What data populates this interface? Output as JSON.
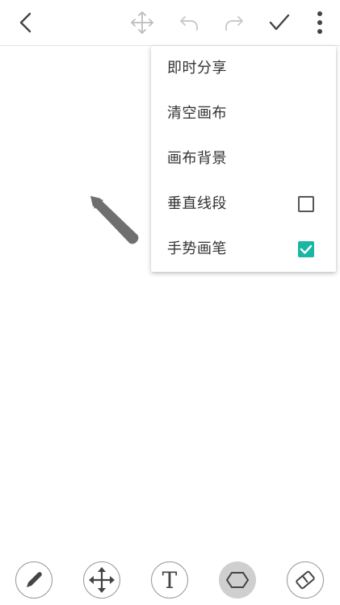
{
  "toolbar_top": {
    "back": "back-arrow-icon",
    "move": "move-arrows-icon",
    "undo": "undo-icon",
    "redo": "redo-icon",
    "confirm": "checkmark-icon",
    "more": "more-vertical-icon"
  },
  "menu": {
    "items": [
      {
        "label": "即时分享",
        "has_checkbox": false
      },
      {
        "label": "清空画布",
        "has_checkbox": false
      },
      {
        "label": "画布背景",
        "has_checkbox": false
      },
      {
        "label": "垂直线段",
        "has_checkbox": true,
        "checked": false
      },
      {
        "label": "手势画笔",
        "has_checkbox": true,
        "checked": true
      }
    ]
  },
  "bottom_tools": [
    {
      "name": "pen-tool",
      "icon": "pen-icon",
      "active": false
    },
    {
      "name": "move-tool",
      "icon": "move-arrows-icon",
      "active": false
    },
    {
      "name": "text-tool",
      "icon": "text-t-icon",
      "text": "T",
      "active": false
    },
    {
      "name": "shape-tool",
      "icon": "hexagon-icon",
      "active": true
    },
    {
      "name": "eraser-tool",
      "icon": "eraser-icon",
      "active": false
    }
  ],
  "colors": {
    "accent": "#1bb5a3",
    "icon_dark": "#444444",
    "icon_disabled": "#bdbdbd",
    "pen_cursor": "#6f6f6f"
  }
}
